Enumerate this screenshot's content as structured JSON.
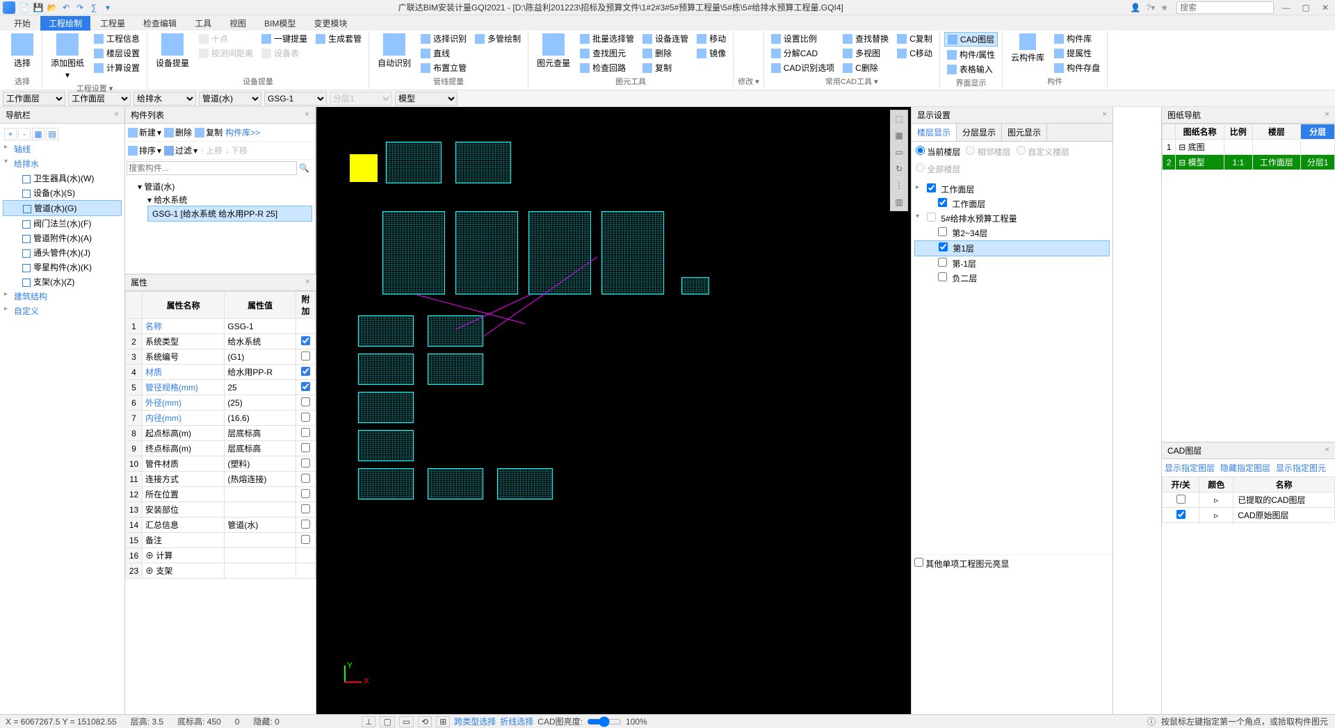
{
  "app": {
    "titlePrefix": "广联达BIM安装计量GQI2021 - ",
    "filePath": "[D:\\陈益利201223\\招标及预算文件\\1#2#3#5#预算工程量\\5#栋\\5#给排水预算工程量.GQI4]",
    "searchPlaceholder": "搜索"
  },
  "menu": {
    "tabs": [
      "开始",
      "工程绘制",
      "工程量",
      "检查编辑",
      "工具",
      "视图",
      "BIM模型",
      "变更模块"
    ],
    "active": 1
  },
  "ribbon": {
    "groups": {
      "select": {
        "label": "选择",
        "items": [
          "选择"
        ]
      },
      "projSettings": {
        "label": "工程设置 ▾",
        "items": [
          "添加图纸",
          "工程信息",
          "楼层设置",
          "计算设置"
        ]
      },
      "devMeasure": {
        "label": "设备提量",
        "big": "设备提量",
        "items": [
          "一键提量",
          "生成套管",
          "十点",
          "设备表",
          "按测间距离"
        ]
      },
      "lineMeasure": {
        "label": "管线提量",
        "big": "自动识别",
        "items": [
          "选择识别",
          "直线",
          "布置立管",
          "多管绘制"
        ]
      },
      "dwgTools": {
        "label": "图元工具",
        "big": "图元查量",
        "items": [
          "批量选择管",
          "查找图元",
          "检查回路",
          "设备连管",
          "删除",
          "复制",
          "移动",
          "镜像"
        ]
      },
      "modify": {
        "label": "修改 ▾"
      },
      "cadTools": {
        "label": "常用CAD工具 ▾",
        "items": [
          "设置比例",
          "分解CAD",
          "CAD识别选项",
          "查找替换",
          "多视图",
          "C删除",
          "C复制",
          "C移动"
        ]
      },
      "uiDisp": {
        "label": "界面显示",
        "items": [
          "CAD图层",
          "构件/属性",
          "表格输入"
        ]
      },
      "cloud": {
        "label": "构件",
        "big": "云构件库",
        "items": [
          "构件库",
          "提属性",
          "构件存盘"
        ]
      }
    }
  },
  "dropdowns": {
    "workLayer1": "工作面层",
    "workLayer2": "工作面层",
    "system": "给排水",
    "pipe": "管道(水)",
    "code": "GSG-1",
    "floor": "分层1",
    "model": "模型"
  },
  "navTree": {
    "title": "导航栏",
    "nodes": [
      {
        "label": "轴线",
        "leaf": false
      },
      {
        "label": "给排水",
        "leaf": false,
        "open": true,
        "children": [
          {
            "label": "卫生器具(水)(W)",
            "leaf": true
          },
          {
            "label": "设备(水)(S)",
            "leaf": true
          },
          {
            "label": "管道(水)(G)",
            "leaf": true,
            "selected": true
          },
          {
            "label": "阀门法兰(水)(F)",
            "leaf": true
          },
          {
            "label": "管道附件(水)(A)",
            "leaf": true
          },
          {
            "label": "通头管件(水)(J)",
            "leaf": true
          },
          {
            "label": "零星构件(水)(K)",
            "leaf": true
          },
          {
            "label": "支架(水)(Z)",
            "leaf": true
          }
        ]
      },
      {
        "label": "建筑结构",
        "leaf": false
      },
      {
        "label": "自定义",
        "leaf": false
      }
    ]
  },
  "componentList": {
    "title": "构件列表",
    "toolbar": [
      "新建",
      "删除",
      "复制",
      "构件库>>",
      "排序",
      "过滤",
      "上移",
      "下移"
    ],
    "searchPlaceholder": "搜索构件...",
    "tree": [
      {
        "label": "管道(水)",
        "children": [
          {
            "label": "给水系统",
            "children": [
              {
                "label": "GSG-1 [给水系统 给水用PP-R 25]",
                "selected": true
              }
            ]
          }
        ]
      }
    ]
  },
  "props": {
    "title": "属性",
    "headers": [
      "属性名称",
      "属性值",
      "附加"
    ],
    "rows": [
      {
        "n": 1,
        "name": "名称",
        "val": "GSG-1",
        "chk": null,
        "link": true
      },
      {
        "n": 2,
        "name": "系统类型",
        "val": "给水系统",
        "chk": true
      },
      {
        "n": 3,
        "name": "系统编号",
        "val": "(G1)",
        "chk": false
      },
      {
        "n": 4,
        "name": "材质",
        "val": "给水用PP-R",
        "chk": true,
        "link": true
      },
      {
        "n": 5,
        "name": "管径规格(mm)",
        "val": "25",
        "chk": true,
        "link": true
      },
      {
        "n": 6,
        "name": "外径(mm)",
        "val": "(25)",
        "chk": false,
        "link": true
      },
      {
        "n": 7,
        "name": "内径(mm)",
        "val": "(16.6)",
        "chk": false,
        "link": true
      },
      {
        "n": 8,
        "name": "起点标高(m)",
        "val": "层底标高",
        "chk": false
      },
      {
        "n": 9,
        "name": "终点标高(m)",
        "val": "层底标高",
        "chk": false
      },
      {
        "n": 10,
        "name": "管件材质",
        "val": "(塑料)",
        "chk": false
      },
      {
        "n": 11,
        "name": "连接方式",
        "val": "(热熔连接)",
        "chk": false
      },
      {
        "n": 12,
        "name": "所在位置",
        "val": "",
        "chk": false
      },
      {
        "n": 13,
        "name": "安装部位",
        "val": "",
        "chk": false
      },
      {
        "n": 14,
        "name": "汇总信息",
        "val": "管道(水)",
        "chk": false
      },
      {
        "n": 15,
        "name": "备注",
        "val": "",
        "chk": false
      },
      {
        "n": 16,
        "name": "计算",
        "val": "",
        "chk": null,
        "group": true
      },
      {
        "n": 23,
        "name": "支架",
        "val": "",
        "chk": null,
        "group": true
      }
    ]
  },
  "displaySettings": {
    "title": "显示设置",
    "tabs": [
      "楼层显示",
      "分层显示",
      "图元显示"
    ],
    "radios": [
      "当前楼层",
      "相邻楼层",
      "自定义楼层",
      "全部楼层"
    ],
    "tree": [
      {
        "label": "工作面层",
        "chk": true,
        "children": [
          {
            "label": "工作面层",
            "chk": true
          }
        ]
      },
      {
        "label": "5#给排水预算工程量",
        "chk": null,
        "open": true,
        "children": [
          {
            "label": "第2~34层",
            "chk": false
          },
          {
            "label": "第1层",
            "chk": true,
            "selected": true
          },
          {
            "label": "第-1层",
            "chk": false
          },
          {
            "label": "负二层",
            "chk": false
          }
        ]
      }
    ],
    "footer": "其他单项工程图元亮显"
  },
  "dwgNav": {
    "title": "图纸导航",
    "headers": [
      "图纸名称",
      "比例",
      "楼层",
      "分层"
    ],
    "rows": [
      {
        "n": 1,
        "name": "底图",
        "scale": "",
        "floor": "",
        "layer": ""
      },
      {
        "n": 2,
        "name": "模型",
        "scale": "1:1",
        "floor": "工作面层",
        "layer": "分层1",
        "active": true
      }
    ]
  },
  "cadLayer": {
    "title": "CAD图层",
    "links": [
      "显示指定图层",
      "隐藏指定图层",
      "显示指定图元"
    ],
    "headers": [
      "开/关",
      "颜色",
      "名称"
    ],
    "rows": [
      {
        "on": false,
        "name": "已提取的CAD图层"
      },
      {
        "on": true,
        "name": "CAD原始图层"
      }
    ]
  },
  "statusBar": {
    "coord": "X = 6067267.5 Y = 151082.55",
    "floorH": "层高: 3.5",
    "baseH": "底标高: 450",
    "zero": "0",
    "hidden": "隐藏: 0",
    "crossSel": "跨类型选择",
    "collapse": "折线选择",
    "cadBright": "CAD图亮度:",
    "cadPct": "100%",
    "hint": "按鼠标左键指定第一个角点，或拾取构件图元"
  },
  "axis": {
    "x": "X",
    "y": "Y"
  }
}
